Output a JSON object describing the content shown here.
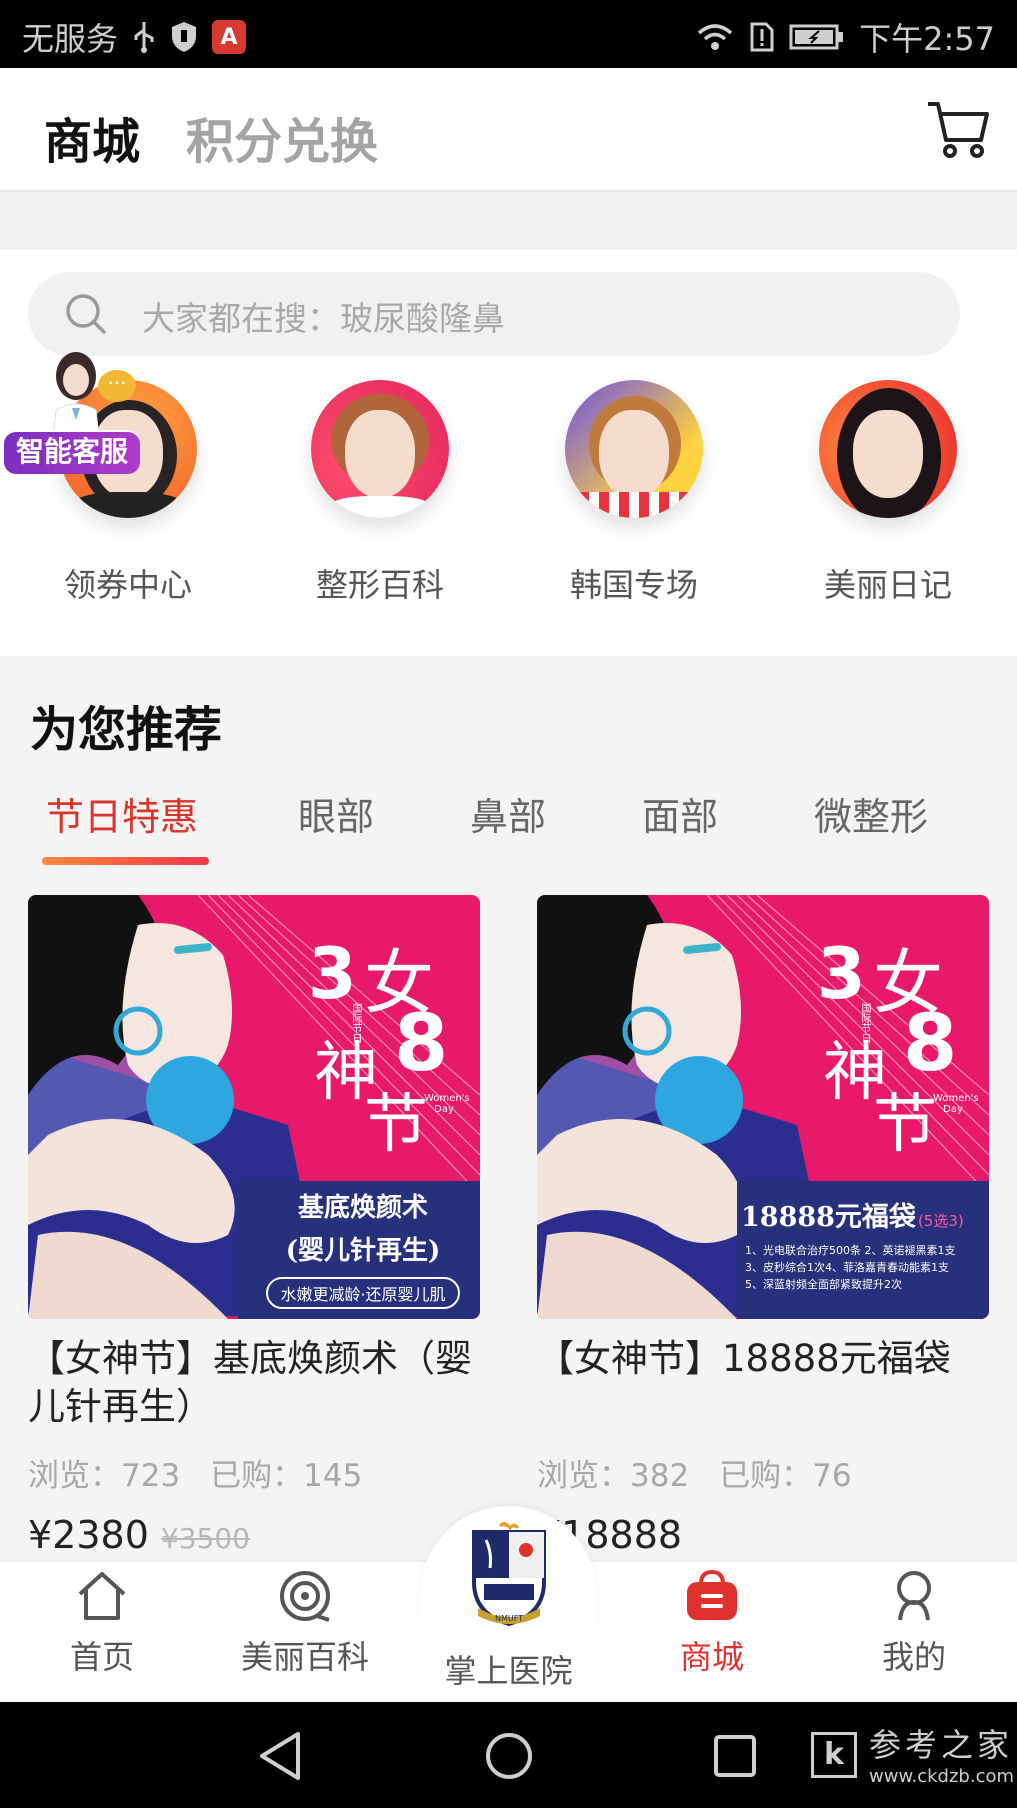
{
  "status_bar": {
    "carrier": "无服务",
    "time": "下午2:57",
    "app_badge": "A"
  },
  "header": {
    "tab_store": "商城",
    "tab_points": "积分兑换"
  },
  "search": {
    "placeholder": "大家都在搜：玻尿酸隆鼻"
  },
  "categories": [
    {
      "label": "领券中心"
    },
    {
      "label": "整形百科"
    },
    {
      "label": "韩国专场"
    },
    {
      "label": "美丽日记"
    }
  ],
  "kefu": {
    "label": "智能客服"
  },
  "recommend": {
    "title": "为您推荐",
    "tabs": [
      "节日特惠",
      "眼部",
      "鼻部",
      "面部",
      "微整形"
    ]
  },
  "products": [
    {
      "title": "【女神节】基底焕颜术（婴儿针再生）",
      "views": "浏览：723",
      "bought": "已购：145",
      "price": "¥2380",
      "old_price": "¥3500",
      "poster": {
        "big1": "3",
        "big2": "8",
        "zh1": "女",
        "zh2": "神",
        "zh3": "节",
        "small": "国际节日",
        "en": "Women's Day",
        "line1": "基底焕颜术",
        "line2": "(婴儿针再生)",
        "line3": "水嫩更减龄·还原婴儿肌"
      }
    },
    {
      "title": "【女神节】18888元福袋",
      "views": "浏览：382",
      "bought": "已购：76",
      "price": "¥18888",
      "poster": {
        "big1": "3",
        "big2": "8",
        "zh1": "女",
        "zh2": "神",
        "zh3": "节",
        "small": "国际节日",
        "en": "Women's Day",
        "line1": "18888元福袋",
        "line1b": "(5选3)",
        "items": [
          "1、光电联合治疗500条 2、英诺褪黑素1支",
          "3、皮秒综合1次4、菲洛嘉青春动能素1支",
          "5、深蓝射频全面部紧致提升2次"
        ]
      }
    }
  ],
  "bottom_nav": {
    "home": "首页",
    "wiki": "美丽百科",
    "hospital": "掌上医院",
    "crest_text": "NMUFT",
    "store": "商城",
    "mine": "我的"
  },
  "watermark": {
    "box": "k",
    "title": "参考之家",
    "url": "www.ckdzb.com"
  },
  "colors": {
    "accent": "#e0322d",
    "poster_pink": "#e8196a",
    "poster_navy": "#27307a"
  }
}
